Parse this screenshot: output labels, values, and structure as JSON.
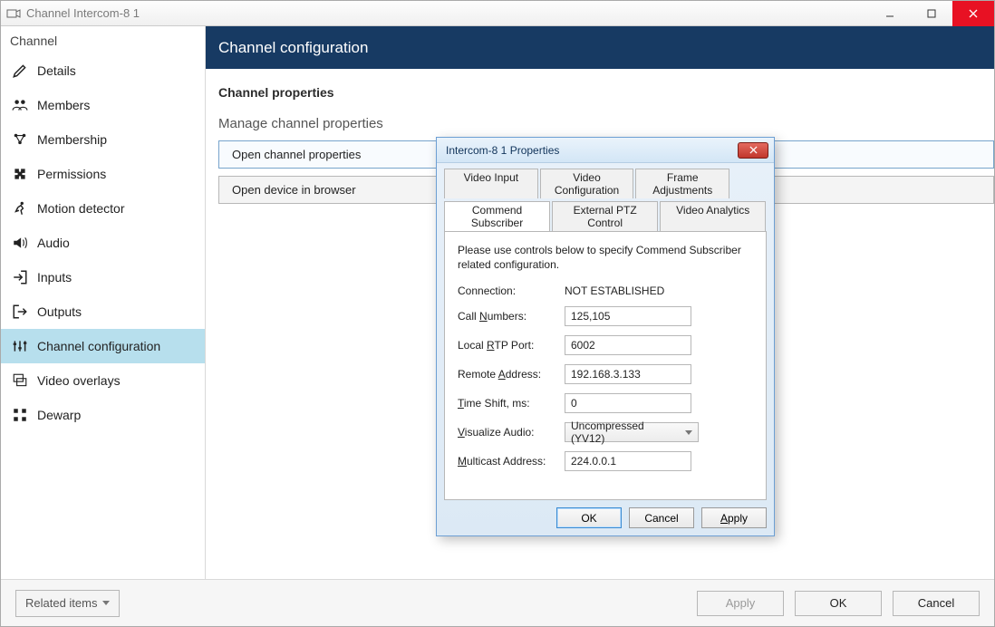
{
  "window": {
    "title": "Channel Intercom-8 1"
  },
  "sidebar": {
    "header": "Channel",
    "items": [
      {
        "label": "Details"
      },
      {
        "label": "Members"
      },
      {
        "label": "Membership"
      },
      {
        "label": "Permissions"
      },
      {
        "label": "Motion detector"
      },
      {
        "label": "Audio"
      },
      {
        "label": "Inputs"
      },
      {
        "label": "Outputs"
      },
      {
        "label": "Channel configuration"
      },
      {
        "label": "Video overlays"
      },
      {
        "label": "Dewarp"
      }
    ]
  },
  "header": {
    "title": "Channel configuration"
  },
  "main": {
    "subtitle": "Channel properties",
    "section_label": "Manage channel properties",
    "open_props_btn": "Open channel properties",
    "open_browser_btn": "Open device in browser"
  },
  "footer": {
    "related": "Related items",
    "apply": "Apply",
    "ok": "OK",
    "cancel": "Cancel"
  },
  "dialog": {
    "title": "Intercom-8 1 Properties",
    "tabs_top": [
      {
        "label": "Video Input"
      },
      {
        "label": "Video Configuration"
      },
      {
        "label": "Frame Adjustments"
      }
    ],
    "tabs_bottom": [
      {
        "label": "Commend Subscriber"
      },
      {
        "label": "External PTZ Control"
      },
      {
        "label": "Video Analytics"
      }
    ],
    "active_tab": "Commend Subscriber",
    "instructions": "Please use controls below to specify Commend Subscriber related configuration.",
    "fields": {
      "connection_label": "Connection:",
      "connection_value": "NOT ESTABLISHED",
      "call_numbers_label_pre": "Call ",
      "call_numbers_ak": "N",
      "call_numbers_label_post": "umbers:",
      "call_numbers_value": "125,105",
      "local_rtp_label_pre": "Local ",
      "local_rtp_ak": "R",
      "local_rtp_label_post": "TP Port:",
      "local_rtp_value": "6002",
      "remote_addr_label_pre": "Remote ",
      "remote_addr_ak": "A",
      "remote_addr_label_post": "ddress:",
      "remote_addr_value": "192.168.3.133",
      "time_shift_ak": "T",
      "time_shift_label_post": "ime Shift, ms:",
      "time_shift_value": "0",
      "visualize_ak": "V",
      "visualize_label_post": "isualize Audio:",
      "visualize_value": "Uncompressed (YV12)",
      "multicast_ak": "M",
      "multicast_label_post": "ulticast Address:",
      "multicast_value": "224.0.0.1"
    },
    "buttons": {
      "ok": "OK",
      "cancel": "Cancel",
      "apply": "Apply"
    }
  }
}
